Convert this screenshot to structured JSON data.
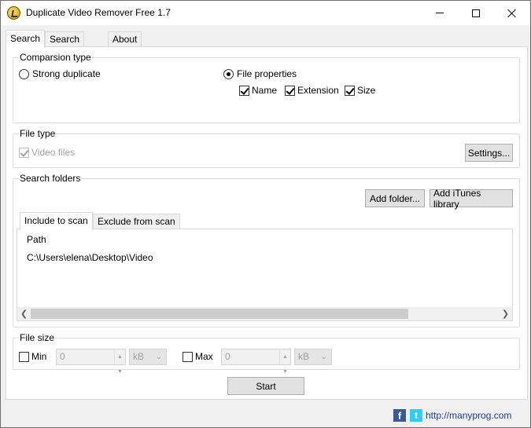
{
  "window": {
    "title": "Duplicate Video Remover Free 1.7"
  },
  "tabs": [
    {
      "label": "Search"
    },
    {
      "label": "Search result"
    },
    {
      "label": "About"
    }
  ],
  "comparison": {
    "title": "Comparsion type",
    "strong_label": "Strong duplicate",
    "file_props_label": "File properties",
    "name_label": "Name",
    "extension_label": "Extension",
    "size_label": "Size"
  },
  "file_type": {
    "title": "File type",
    "video_label": "Video files",
    "settings_label": "Settings..."
  },
  "search_folders": {
    "title": "Search folders",
    "add_folder_label": "Add folder...",
    "add_itunes_label": "Add iTunes library",
    "include_tab": "Include to scan",
    "exclude_tab": "Exclude from scan",
    "column_path": "Path",
    "rows": [
      "C:\\Users\\elena\\Desktop\\Video"
    ]
  },
  "file_size": {
    "title": "File size",
    "min_label": "Min",
    "min_value": "0",
    "min_unit": "kB",
    "max_label": "Max",
    "max_value": "0",
    "max_unit": "kB"
  },
  "start_label": "Start",
  "footer": {
    "fb": "f",
    "tw": "t",
    "link": "http://manyprog.com"
  },
  "colors": {
    "facebook": "#3b5998",
    "twitter": "#33ccff",
    "link": "#1a3c8a"
  }
}
